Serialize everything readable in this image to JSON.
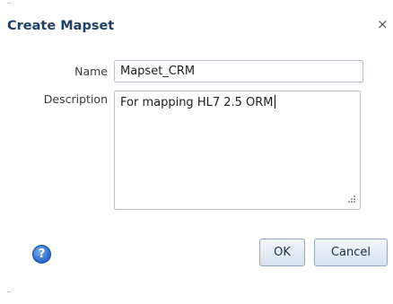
{
  "dialog": {
    "title": "Create Mapset",
    "close_glyph": "×"
  },
  "form": {
    "name_label": "Name",
    "name_value": "Mapset_CRM",
    "description_label": "Description",
    "description_value": "For mapping HL7 2.5 ORM"
  },
  "footer": {
    "help_glyph": "?",
    "ok_label": "OK",
    "cancel_label": "Cancel"
  },
  "icons": {
    "help": "help-icon",
    "close": "close-icon",
    "resize": "resize-grip-icon"
  },
  "colors": {
    "title": "#1f3f66",
    "button_border": "#8fa8c4",
    "help_blue": "#2f6fd0"
  }
}
